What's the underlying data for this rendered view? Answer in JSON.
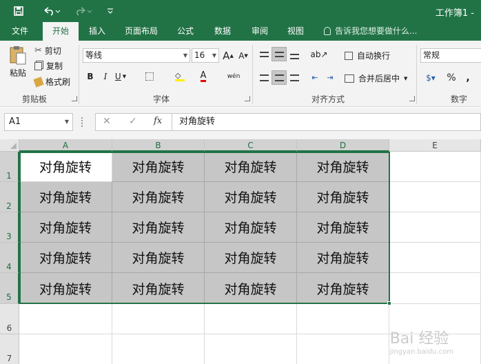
{
  "titlebar": {
    "title": "工作簿1 -",
    "save_icon": "save-icon",
    "undo_icon": "undo-icon",
    "redo_icon": "redo-icon",
    "customize_icon": "customize-icon"
  },
  "tabs": [
    {
      "label": "文件"
    },
    {
      "label": "开始"
    },
    {
      "label": "插入"
    },
    {
      "label": "页面布局"
    },
    {
      "label": "公式"
    },
    {
      "label": "数据"
    },
    {
      "label": "审阅"
    },
    {
      "label": "视图"
    }
  ],
  "tell_me": "告诉我您想要做什么...",
  "clipboard": {
    "paste": "粘贴",
    "cut": "剪切",
    "copy": "复制",
    "format_painter": "格式刷",
    "group": "剪贴板"
  },
  "font": {
    "name": "等线",
    "size": "16",
    "grow": "A",
    "shrink": "A",
    "bold": "B",
    "italic": "I",
    "underline": "U",
    "font_color_letter": "A",
    "phonetic": "wén",
    "group": "字体"
  },
  "alignment": {
    "wrap": "自动换行",
    "merge": "合并后居中",
    "group": "对齐方式"
  },
  "number": {
    "format": "常规",
    "percent": "%",
    "comma": ",",
    "group": "数字"
  },
  "formula_bar": {
    "name_box": "A1",
    "fx": "fx",
    "content": "对角旋转"
  },
  "grid": {
    "columns": [
      "A",
      "B",
      "C",
      "D",
      "E"
    ],
    "rows": [
      "1",
      "2",
      "3",
      "4",
      "5",
      "6",
      "7"
    ],
    "cells": [
      [
        "对角旋转",
        "对角旋转",
        "对角旋转",
        "对角旋转"
      ],
      [
        "对角旋转",
        "对角旋转",
        "对角旋转",
        "对角旋转"
      ],
      [
        "对角旋转",
        "对角旋转",
        "对角旋转",
        "对角旋转"
      ],
      [
        "对角旋转",
        "对角旋转",
        "对角旋转",
        "对角旋转"
      ],
      [
        "对角旋转",
        "对角旋转",
        "对角旋转",
        "对角旋转"
      ]
    ]
  },
  "colors": {
    "accent": "#217346",
    "selection_fill": "#c6c6c6"
  },
  "watermark": {
    "brand": "Bai 经验",
    "url": "jingyan.baidu.com"
  }
}
